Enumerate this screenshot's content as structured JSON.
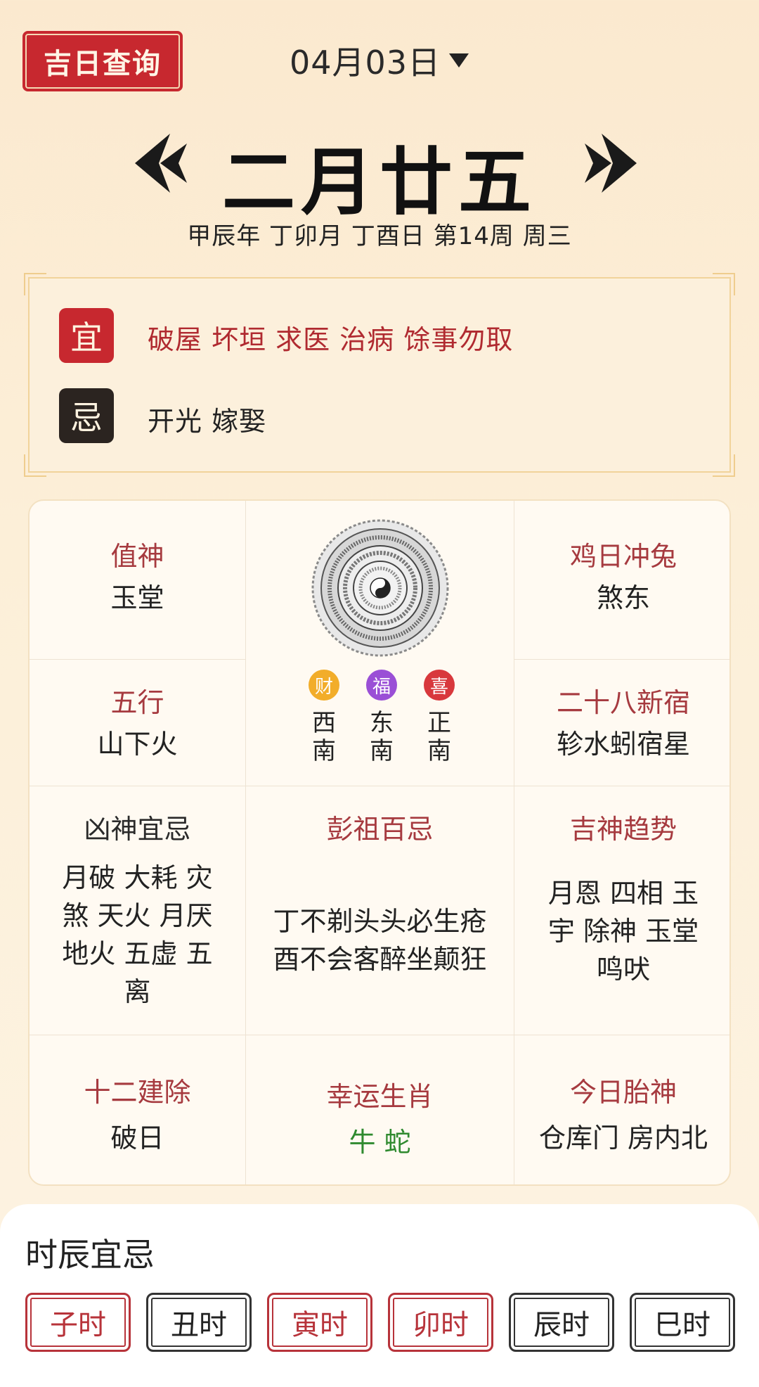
{
  "header": {
    "logo_text": "吉日查询",
    "date_label": "04月03日"
  },
  "lunar": {
    "date": "二月廿五",
    "ganzhi_line": "甲辰年 丁卯月 丁酉日 第14周 周三"
  },
  "yiji": {
    "yi_label": "宜",
    "yi_text": "破屋 坏垣 求医 治病 馀事勿取",
    "ji_label": "忌",
    "ji_text": "开光 嫁娶"
  },
  "grid": {
    "zhishen": {
      "title": "值神",
      "value": "玉堂"
    },
    "chong": {
      "title": "鸡日冲兔",
      "value": "煞东"
    },
    "wuxing": {
      "title": "五行",
      "value": "山下火"
    },
    "xiu": {
      "title": "二十八新宿",
      "value": "轸水蚓宿星"
    },
    "xiongshen": {
      "title": "凶神宜忌",
      "value": "月破 大耗 灾煞 天火 月厌地火 五虚 五离"
    },
    "pengzu": {
      "title": "彭祖百忌",
      "line1": "丁不剃头头必生疮",
      "line2": "酉不会客醉坐颠狂"
    },
    "jishen": {
      "title": "吉神趋势",
      "value": "月恩 四相 玉宇 除神 玉堂鸣吠"
    },
    "jianchu": {
      "title": "十二建除",
      "value": "破日"
    },
    "shengxiao": {
      "title": "幸运生肖",
      "value": "牛 蛇"
    },
    "taishen": {
      "title": "今日胎神",
      "value": "仓库门 房内北"
    }
  },
  "gods": [
    {
      "badge": "财",
      "dir1": "西",
      "dir2": "南",
      "color": "#f2ad2a"
    },
    {
      "badge": "福",
      "dir1": "东",
      "dir2": "南",
      "color": "#9a4fd6"
    },
    {
      "badge": "喜",
      "dir1": "正",
      "dir2": "南",
      "color": "#d8383c"
    }
  ],
  "shichen": {
    "title": "时辰宜忌",
    "hours": [
      {
        "label": "子时",
        "tone": "red"
      },
      {
        "label": "丑时",
        "tone": "dark"
      },
      {
        "label": "寅时",
        "tone": "red"
      },
      {
        "label": "卯时",
        "tone": "red"
      },
      {
        "label": "辰时",
        "tone": "dark"
      },
      {
        "label": "巳时",
        "tone": "dark"
      }
    ]
  },
  "icons": {
    "prev": "double-chevron-left-icon",
    "next": "double-chevron-right-icon",
    "dropdown": "triangle-down-icon",
    "compass": "luopan-compass-icon"
  }
}
